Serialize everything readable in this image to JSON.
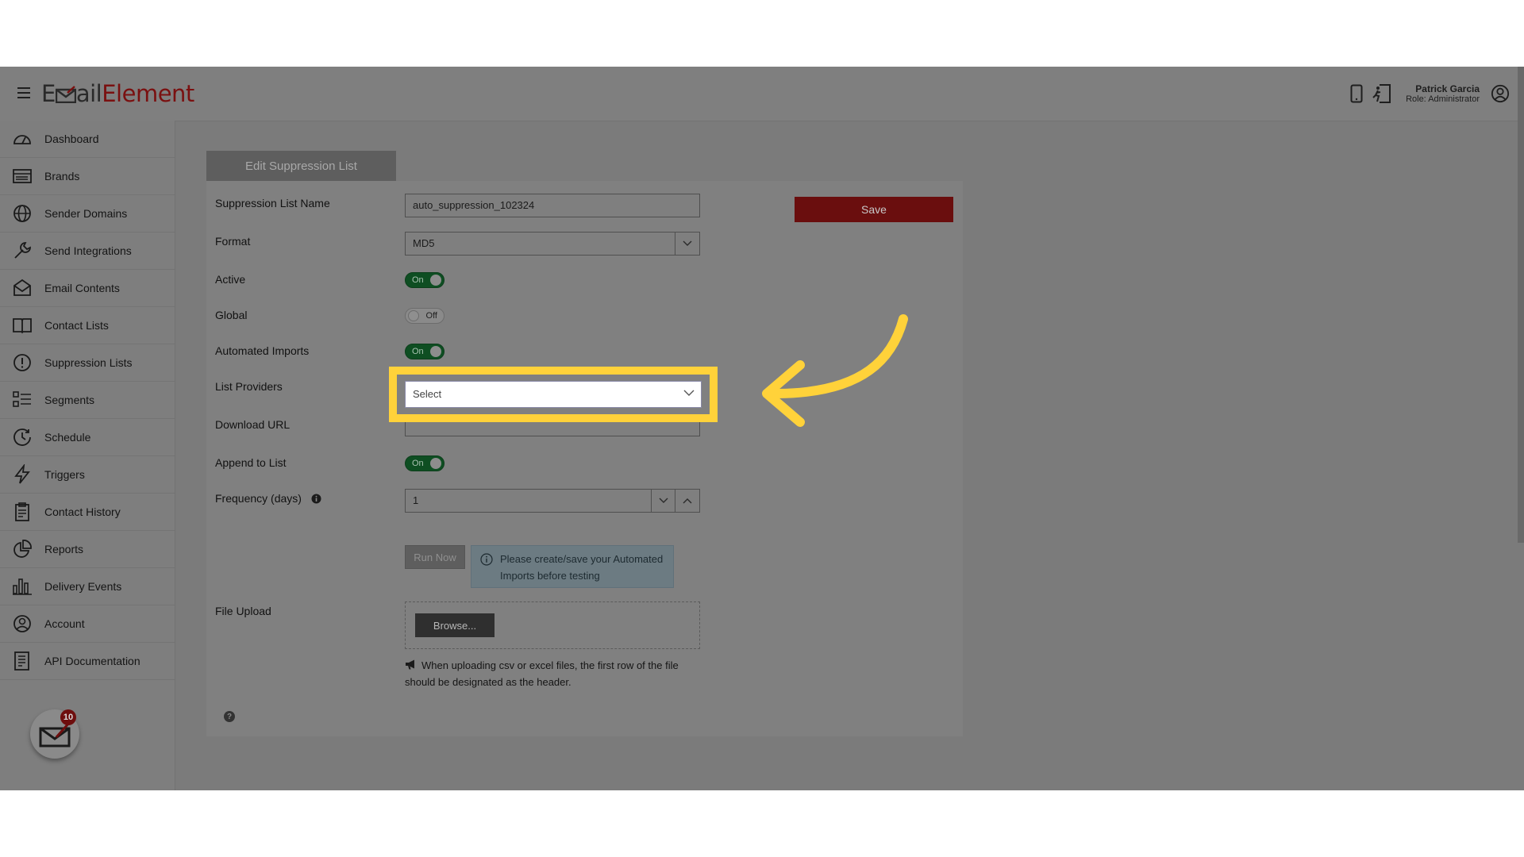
{
  "brand": {
    "logo_prefix": "E",
    "logo_ail": "ail",
    "logo_element": "Element"
  },
  "user": {
    "name": "Patrick Garcia",
    "role": "Role: Administrator"
  },
  "sidebar": {
    "items": [
      {
        "label": "Dashboard",
        "icon": "dashboard-icon"
      },
      {
        "label": "Brands",
        "icon": "brands-icon"
      },
      {
        "label": "Sender Domains",
        "icon": "globe-icon"
      },
      {
        "label": "Send Integrations",
        "icon": "wrench-icon"
      },
      {
        "label": "Email Contents",
        "icon": "envelope-icon"
      },
      {
        "label": "Contact Lists",
        "icon": "book-icon"
      },
      {
        "label": "Suppression Lists",
        "icon": "alert-circle-icon"
      },
      {
        "label": "Segments",
        "icon": "segments-icon"
      },
      {
        "label": "Schedule",
        "icon": "clock-icon"
      },
      {
        "label": "Triggers",
        "icon": "lightning-icon"
      },
      {
        "label": "Contact History",
        "icon": "clipboard-icon"
      },
      {
        "label": "Reports",
        "icon": "pie-chart-icon"
      },
      {
        "label": "Delivery Events",
        "icon": "bar-chart-icon"
      },
      {
        "label": "Account",
        "icon": "user-circle-icon"
      },
      {
        "label": "API Documentation",
        "icon": "document-icon"
      }
    ],
    "notification_count": "10"
  },
  "form": {
    "tab_title": "Edit Suppression List",
    "save_label": "Save",
    "name_label": "Suppression List Name",
    "name_value": "auto_suppression_102324",
    "format_label": "Format",
    "format_value": "MD5",
    "active_label": "Active",
    "active_state": "On",
    "global_label": "Global",
    "global_state": "Off",
    "automated_label": "Automated Imports",
    "automated_state": "On",
    "providers_label": "List Providers",
    "providers_value": "Select",
    "download_label": "Download URL",
    "download_value": "",
    "append_label": "Append to List",
    "append_state": "On",
    "frequency_label": "Frequency (days)",
    "frequency_value": "1",
    "run_now_label": "Run Now",
    "info_text": "Please create/save your Automated Imports before testing",
    "upload_label": "File Upload",
    "browse_label": "Browse...",
    "upload_note": "When uploading csv or excel files, the first row of the file should be designated as the header."
  },
  "colors": {
    "highlight": "#ffd23a",
    "save": "#6a0e0e",
    "toggle_on": "#0e4e22"
  }
}
